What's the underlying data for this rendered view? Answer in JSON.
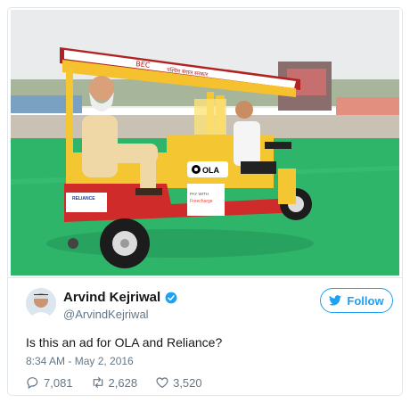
{
  "tweet": {
    "author_name": "Arvind Kejriwal",
    "author_handle": "@ArvindKejriwal",
    "follow_label": "Follow",
    "text": "Is this an ad for OLA and Reliance?",
    "timestamp": "8:34 AM - May 2, 2016",
    "replies": "7,081",
    "retweets": "2,628",
    "likes": "3,520"
  },
  "photo": {
    "canopy_text": "BEC",
    "canopy_hindi": "पश्चिम बंगाल सरकार",
    "ola_label": "OLA",
    "pay_label": "PAY WITH",
    "freecharge_label": "Freecharge",
    "reliance_label": "RELIANCE"
  },
  "colors": {
    "accent": "#1da1f2",
    "text_primary": "#14171a",
    "text_secondary": "#657786",
    "grass": "#2fb56a"
  }
}
